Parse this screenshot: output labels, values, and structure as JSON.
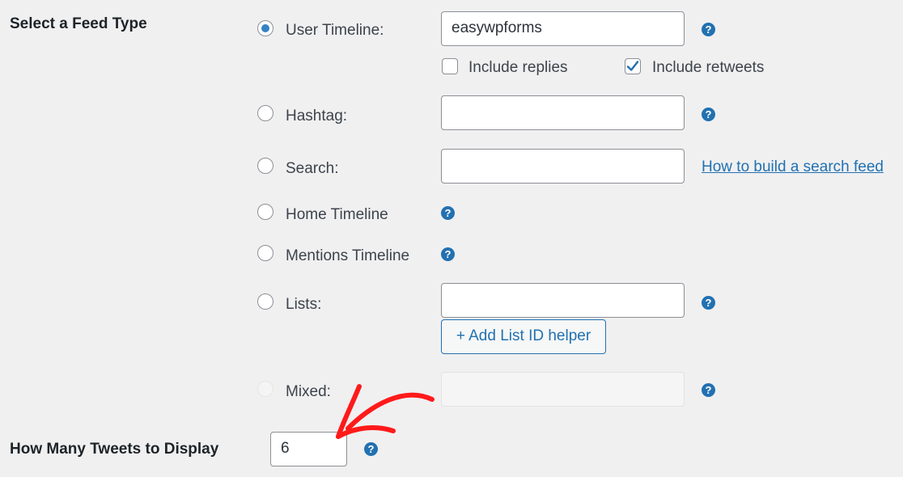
{
  "feed_type": {
    "heading": "Select a Feed Type",
    "options": [
      {
        "label": "User Timeline:",
        "checked": true,
        "input_value": "easywpforms"
      },
      {
        "label": "Hashtag:",
        "checked": false,
        "input_value": ""
      },
      {
        "label": "Search:",
        "checked": false,
        "input_value": "",
        "link": "How to build a search feed"
      },
      {
        "label": "Home Timeline",
        "checked": false
      },
      {
        "label": "Mentions Timeline",
        "checked": false
      },
      {
        "label": "Lists:",
        "checked": false,
        "input_value": "",
        "button": "+ Add List ID helper"
      },
      {
        "label": "Mixed:",
        "checked": false,
        "disabled": true,
        "input_value": ""
      }
    ],
    "include_replies": {
      "label": "Include replies",
      "checked": false
    },
    "include_retweets": {
      "label": "Include retweets",
      "checked": true
    }
  },
  "tweet_count": {
    "heading": "How Many Tweets to Display",
    "value": "6"
  },
  "icons": {
    "help": "?",
    "help_icon_name": "question-circle-icon"
  },
  "colors": {
    "accent": "#2271b1",
    "radio_checked": "#3582c4",
    "annotation_arrow": "#ff0000",
    "background": "#f0f0f1"
  }
}
